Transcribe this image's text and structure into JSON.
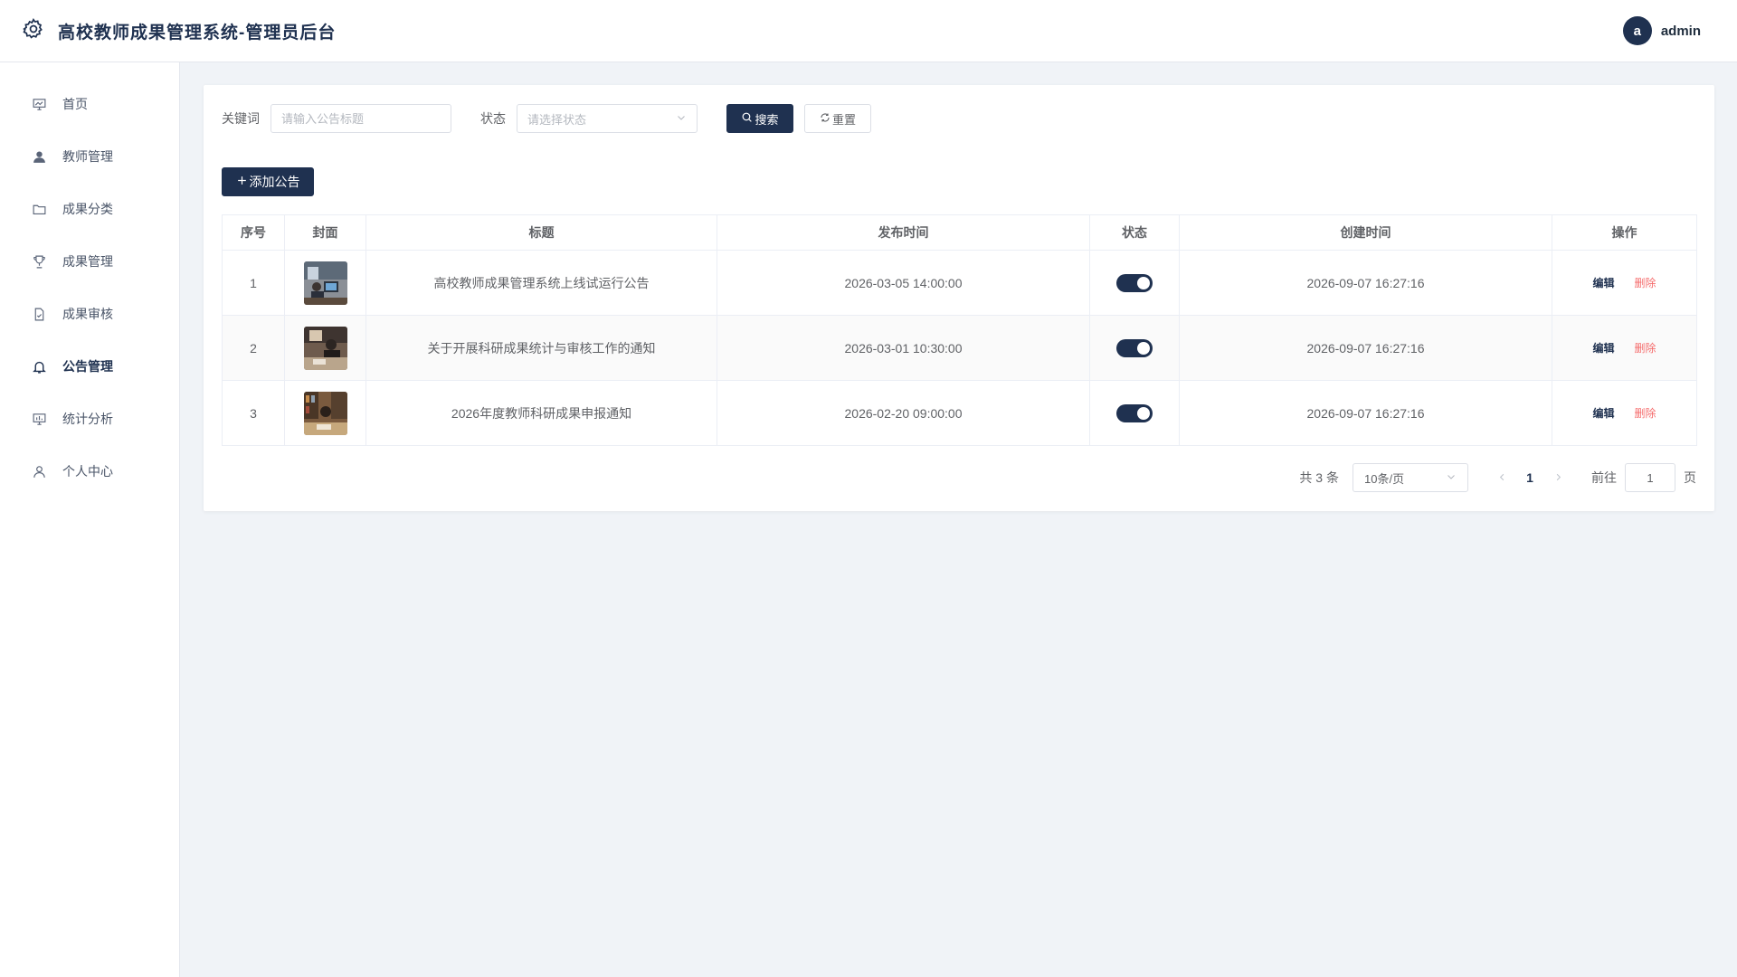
{
  "header": {
    "title": "高校教师成果管理系统-管理员后台",
    "avatar_letter": "a",
    "username": "admin"
  },
  "sidebar": {
    "items": [
      {
        "label": "首页",
        "icon": "dashboard-icon",
        "active": false
      },
      {
        "label": "教师管理",
        "icon": "user-icon",
        "active": false
      },
      {
        "label": "成果分类",
        "icon": "folder-icon",
        "active": false
      },
      {
        "label": "成果管理",
        "icon": "trophy-icon",
        "active": false
      },
      {
        "label": "成果审核",
        "icon": "document-check-icon",
        "active": false
      },
      {
        "label": "公告管理",
        "icon": "bell-icon",
        "active": true
      },
      {
        "label": "统计分析",
        "icon": "chart-board-icon",
        "active": false
      },
      {
        "label": "个人中心",
        "icon": "person-outline-icon",
        "active": false
      }
    ]
  },
  "search": {
    "keyword_label": "关键词",
    "keyword_placeholder": "请输入公告标题",
    "keyword_value": "",
    "status_label": "状态",
    "status_placeholder": "请选择状态",
    "search_button": "搜索",
    "reset_button": "重置"
  },
  "toolbar": {
    "add_button": "添加公告"
  },
  "table": {
    "columns": [
      "序号",
      "封面",
      "标题",
      "发布时间",
      "状态",
      "创建时间",
      "操作"
    ],
    "rows": [
      {
        "index": "1",
        "title": "高校教师成果管理系统上线试运行公告",
        "publish_time": "2026-03-05 14:00:00",
        "status_on": true,
        "create_time": "2026-09-07 16:27:16",
        "edit": "编辑",
        "delete": "删除"
      },
      {
        "index": "2",
        "title": "关于开展科研成果统计与审核工作的通知",
        "publish_time": "2026-03-01 10:30:00",
        "status_on": true,
        "create_time": "2026-09-07 16:27:16",
        "edit": "编辑",
        "delete": "删除"
      },
      {
        "index": "3",
        "title": "2026年度教师科研成果申报通知",
        "publish_time": "2026-02-20 09:00:00",
        "status_on": true,
        "create_time": "2026-09-07 16:27:16",
        "edit": "编辑",
        "delete": "删除"
      }
    ]
  },
  "pagination": {
    "total_text": "共 3 条",
    "page_size": "10条/页",
    "current_page": "1",
    "goto_label": "前往",
    "goto_value": "1",
    "page_suffix": "页"
  },
  "colors": {
    "primary": "#1f3150",
    "danger": "#f56c6c"
  }
}
